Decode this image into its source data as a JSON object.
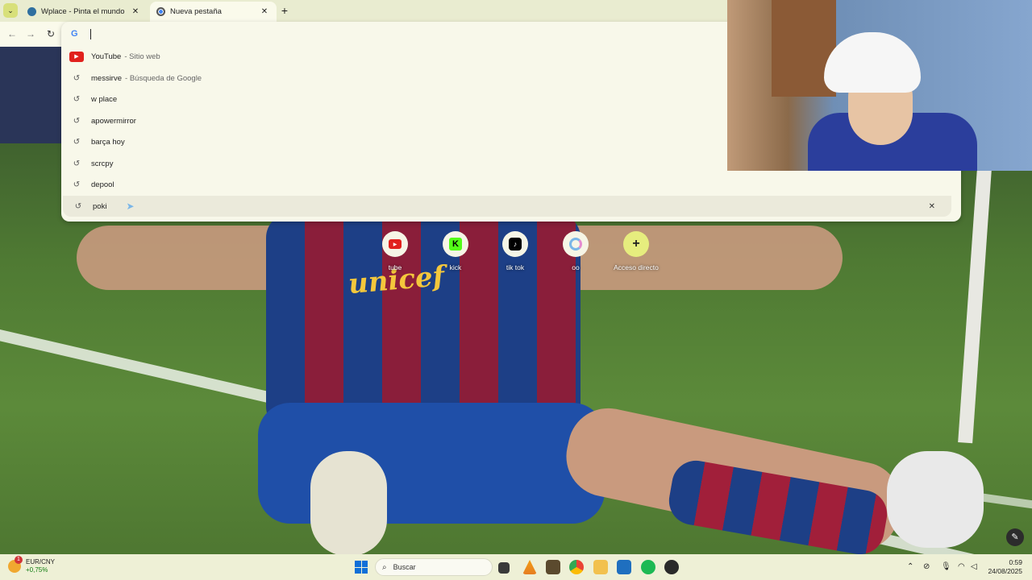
{
  "browser": {
    "tabs": [
      {
        "title": "Wplace - Pinta el mundo",
        "active": false,
        "close": "✕"
      },
      {
        "title": "Nueva pestaña",
        "active": true,
        "close": "✕"
      }
    ],
    "new_tab": "+",
    "tab_search": "⌄",
    "nav": {
      "back": "←",
      "forward": "→",
      "reload": "↻"
    }
  },
  "omnibox": {
    "value": "",
    "search_engine_icon": "G",
    "suggestions": [
      {
        "icon": "youtube-icon",
        "text": "YouTube",
        "sub": "- Sitio web"
      },
      {
        "icon": "history-icon",
        "text": "messirve",
        "sub": "- Búsqueda de Google"
      },
      {
        "icon": "history-icon",
        "text": "w place",
        "sub": ""
      },
      {
        "icon": "history-icon",
        "text": "apowermirror",
        "sub": ""
      },
      {
        "icon": "history-icon",
        "text": "barça hoy",
        "sub": ""
      },
      {
        "icon": "history-icon",
        "text": "scrcpy",
        "sub": ""
      },
      {
        "icon": "history-icon",
        "text": "depool",
        "sub": ""
      },
      {
        "icon": "history-icon",
        "text": "poki",
        "sub": "",
        "selected": true
      }
    ],
    "remove": "✕"
  },
  "shortcuts": [
    {
      "label": "tube",
      "icon": "youtube-icon"
    },
    {
      "label": "kick",
      "icon": "kick-icon"
    },
    {
      "label": "tik tok",
      "icon": "tiktok-icon"
    },
    {
      "label": "oo",
      "icon": "oo-icon"
    },
    {
      "label": "Acceso directo",
      "icon": "plus-icon"
    }
  ],
  "background_text": {
    "sponsor": "unicef"
  },
  "taskbar": {
    "widget": {
      "label": "EUR/CNY",
      "change": "+0,75%",
      "badge": "1"
    },
    "search_placeholder": "Buscar",
    "time": "0:59",
    "date": "24/08/2025"
  },
  "colors": {
    "accent": "#e6ed7e",
    "chrome": "#fafaeb",
    "youtube": "#e1211d",
    "kick": "#53fc18"
  }
}
